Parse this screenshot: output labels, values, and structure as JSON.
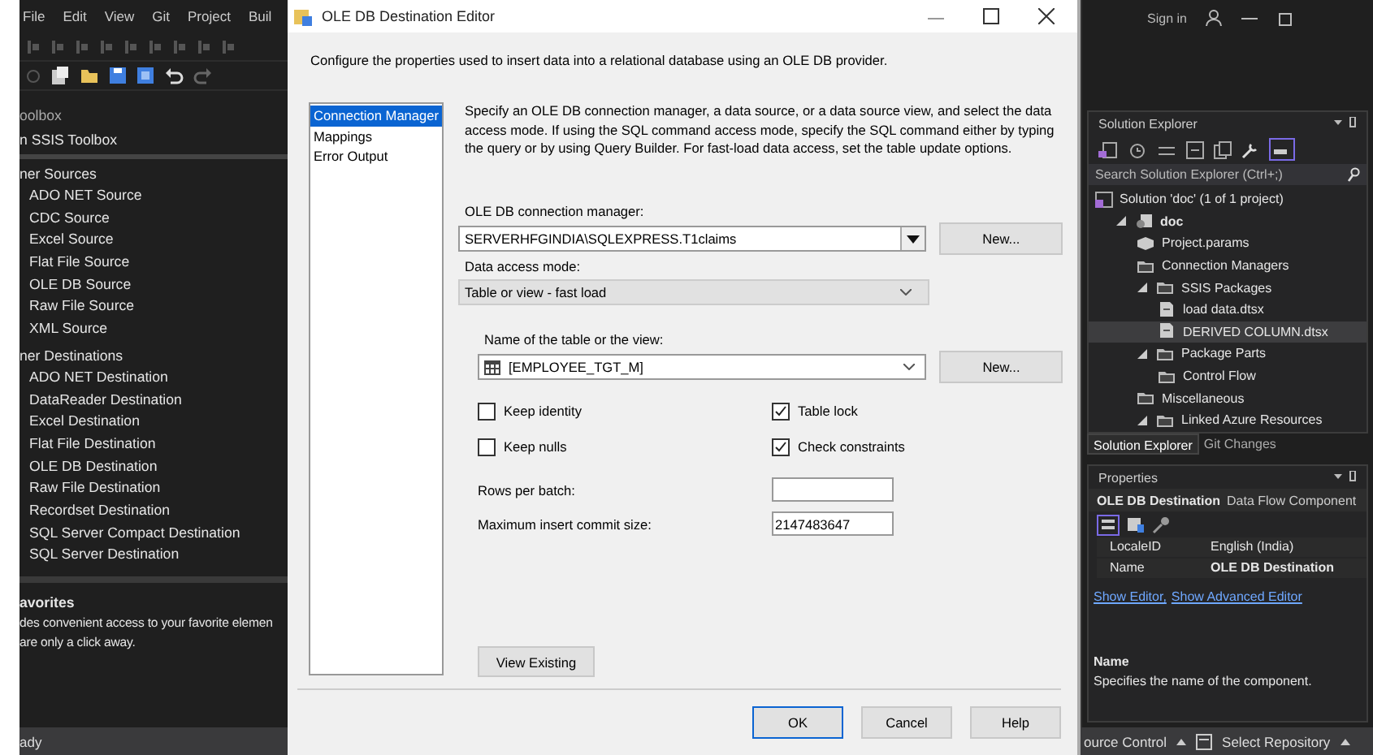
{
  "ide": {
    "menu": [
      "File",
      "Edit",
      "View",
      "Git",
      "Project",
      "Buil"
    ],
    "toolbox": {
      "title": "oolbox",
      "search_label": "n SSIS Toolbox",
      "groups": [
        {
          "title": "ner Sources",
          "items": [
            "ADO NET Source",
            "CDC Source",
            "Excel Source",
            "Flat File Source",
            "OLE DB Source",
            "Raw File Source",
            "XML Source"
          ]
        },
        {
          "title": "ner Destinations",
          "items": [
            "ADO NET Destination",
            "DataReader Destination",
            "Excel Destination",
            "Flat File Destination",
            "OLE DB Destination",
            "Raw File Destination",
            "Recordset Destination",
            "SQL Server Compact Destination",
            "SQL Server Destination"
          ]
        }
      ],
      "info_title": "avorites",
      "info_lines": [
        "des convenient access to your favorite elemen",
        "are only a click away."
      ]
    },
    "sign_in": "Sign in",
    "solution_explorer": {
      "title": "Solution Explorer",
      "search_placeholder": "Search Solution Explorer (Ctrl+;)",
      "tree": [
        {
          "label": "Solution 'doc' (1 of 1 project)",
          "kind": "solution",
          "selected": false,
          "children": [
            {
              "label": "doc",
              "kind": "project",
              "selected": false,
              "expanded": true,
              "children": [
                {
                  "label": "Project.params",
                  "kind": "params",
                  "selected": false
                },
                {
                  "label": "Connection Managers",
                  "kind": "folder",
                  "selected": false
                },
                {
                  "label": "SSIS Packages",
                  "kind": "folder",
                  "selected": false,
                  "expanded": true,
                  "children": [
                    {
                      "label": "load data.dtsx",
                      "kind": "file",
                      "selected": false
                    },
                    {
                      "label": "DERIVED COLUMN.dtsx",
                      "kind": "file",
                      "selected": true
                    }
                  ]
                },
                {
                  "label": "Package Parts",
                  "kind": "folder",
                  "selected": false,
                  "expanded": true,
                  "children": [
                    {
                      "label": "Control Flow",
                      "kind": "folder",
                      "selected": false
                    }
                  ]
                },
                {
                  "label": "Miscellaneous",
                  "kind": "folder",
                  "selected": false
                },
                {
                  "label": "Linked Azure Resources",
                  "kind": "folder",
                  "selected": false,
                  "expanded": true
                }
              ]
            }
          ]
        }
      ],
      "tabs": [
        {
          "label": "Solution Explorer",
          "selected": true
        },
        {
          "label": "Git Changes",
          "selected": false
        }
      ]
    },
    "properties": {
      "title": "Properties",
      "object_name": "OLE DB Destination",
      "object_type": "Data Flow Component",
      "rows": [
        {
          "name": "LocaleID",
          "value": "English (India)",
          "bold": false
        },
        {
          "name": "Name",
          "value": "OLE DB Destination",
          "bold": true
        }
      ],
      "links": [
        "Show Editor,",
        "Show Advanced Editor"
      ],
      "desc_title": "Name",
      "desc_text": "Specifies the name of the component."
    },
    "status_bar": {
      "text": "ady",
      "items": [
        "ource Control",
        "Select Repository"
      ]
    }
  },
  "dialog": {
    "title": "OLE DB Destination Editor",
    "description": "Configure the properties used to insert data into a relational database using an OLE DB provider.",
    "pages": [
      {
        "label": "Connection Manager",
        "selected": true
      },
      {
        "label": "Mappings",
        "selected": false
      },
      {
        "label": "Error Output",
        "selected": false
      }
    ],
    "intro": "Specify an OLE DB connection manager, a data source, or a data source view, and select the data access mode. If using the SQL command access mode, specify the SQL command either by typing the query or by using Query Builder. For fast-load data access, set the table update options.",
    "connection_label": "OLE DB connection manager:",
    "connection_value": "SERVERHFGINDIA\\SQLEXPRESS.T1claims",
    "new_button": "New...",
    "access_label": "Data access mode:",
    "access_value": "Table or view - fast load",
    "table_label": "Name of the table or the view:",
    "table_value": "[EMPLOYEE_TGT_M]",
    "table_new_button": "New...",
    "options": [
      {
        "label": "Keep identity",
        "checked": false
      },
      {
        "label": "Table lock",
        "checked": true
      },
      {
        "label": "Keep nulls",
        "checked": false
      },
      {
        "label": "Check constraints",
        "checked": true
      }
    ],
    "fields": [
      {
        "label": "Rows per batch:"
      },
      {
        "label": "Maximum insert commit size:",
        "value": "2147483647"
      }
    ],
    "view_button": "View Existing",
    "buttons": [
      "OK",
      "Cancel",
      "Help"
    ]
  }
}
